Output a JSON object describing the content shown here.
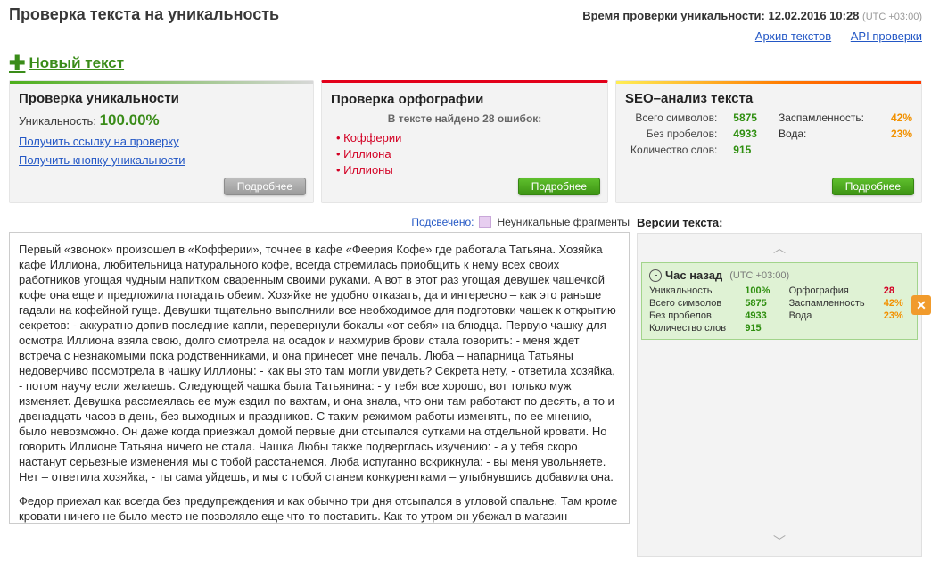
{
  "header": {
    "title": "Проверка текста на уникальность",
    "time_label": "Время проверки уникальности:",
    "time_value": "12.02.2016 10:28",
    "tz": "(UTC +03:00)"
  },
  "top_links": {
    "archive": "Архив текстов",
    "api": "API проверки"
  },
  "new_text": "Новый текст",
  "box_uniq": {
    "title": "Проверка уникальности",
    "label": "Уникальность:",
    "value": "100.00%",
    "link1": "Получить ссылку на проверку",
    "link2": "Получить кнопку уникальности",
    "more": "Подробнее"
  },
  "box_orf": {
    "title": "Проверка орфографии",
    "sub": "В тексте найдено 28 ошибок:",
    "errors": [
      "Кофферии",
      "Иллиона",
      "Иллионы"
    ],
    "more": "Подробнее"
  },
  "box_seo": {
    "title": "SEO–анализ текста",
    "rows": [
      {
        "l": "Всего символов:",
        "v": "5875",
        "l2": "Заспамленность:",
        "v2": "42%"
      },
      {
        "l": "Без пробелов:",
        "v": "4933",
        "l2": "Вода:",
        "v2": "23%"
      },
      {
        "l": "Количество слов:",
        "v": "915",
        "l2": "",
        "v2": ""
      }
    ],
    "more": "Подробнее"
  },
  "legend": {
    "label": "Подсвечено:",
    "item": "Неуникальные фрагменты"
  },
  "text_body": {
    "p1": "Первый «звонок» произошел в «Кофферии», точнее в кафе «Феерия Кофе» где работала Татьяна. Хозяйка кафе Иллиона, любительница натурального кофе, всегда стремилась приобщить к нему всех своих работников угощая чудным напитком сваренным своими руками. А вот в этот раз угощая девушек чашечкой кофе она еще и предложила погадать обеим. Хозяйке не удобно отказать, да и интересно – как это раньше гадали на кофейной гуще. Девушки тщательно выполнили все необходимое для подготовки чашек к открытию секретов: - аккуратно допив последние капли, перевернули бокалы «от себя» на блюдца. Первую чашку для осмотра Иллиона взяла свою, долго смотрела на осадок и нахмурив брови стала говорить: - меня ждет встреча с незнакомыми пока родственниками, и она принесет мне печаль. Люба – напарница Татьяны недоверчиво посмотрела в чашку Иллионы: - как вы это там могли увидеть? Секрета нету, - ответила хозяйка, - потом научу если желаешь. Следующей чашка была Татьянина: - у тебя все хорошо, вот только муж изменяет. Девушка рассмеялась ее муж ездил по вахтам, и она знала, что они там работают по десять, а то и двенадцать часов в день, без выходных и праздников. С таким режимом работы изменять, по ее мнению, было невозможно. Он даже когда приезжал домой первые дни отсыпался сутками на отдельной кровати. Но говорить Иллионе Татьяна ничего не стала. Чашка Любы также подверглась изучению: - а у тебя скоро настанут серьезные изменения мы с тобой расстанемся. Люба испуганно вскрикнула: - вы меня увольняете. Нет – ответила хозяйка, - ты сама уйдешь, и мы с тобой станем конкурентками – улыбнувшись добавила она.",
    "p2": "Федор приехал как всегда без предупреждения и как обычно три дня отсыпался в угловой спальне. Там кроме кровати ничего не было место не позволяло еще что-то поставить. Как-то утром он убежал в магазин"
  },
  "versions": {
    "title": "Версии текста:",
    "item": {
      "time": "Час назад",
      "tz": "(UTC +03:00)",
      "rows": [
        {
          "l": "Уникальность",
          "v": "100%",
          "l2": "Орфография",
          "v2": "28",
          "c2": "#d30024"
        },
        {
          "l": "Всего символов",
          "v": "5875",
          "l2": "Заспамленность",
          "v2": "42%",
          "c2": "#f29100"
        },
        {
          "l": "Без пробелов",
          "v": "4933",
          "l2": "Вода",
          "v2": "23%",
          "c2": "#f29100"
        },
        {
          "l": "Количество слов",
          "v": "915",
          "l2": "",
          "v2": ""
        }
      ]
    }
  }
}
